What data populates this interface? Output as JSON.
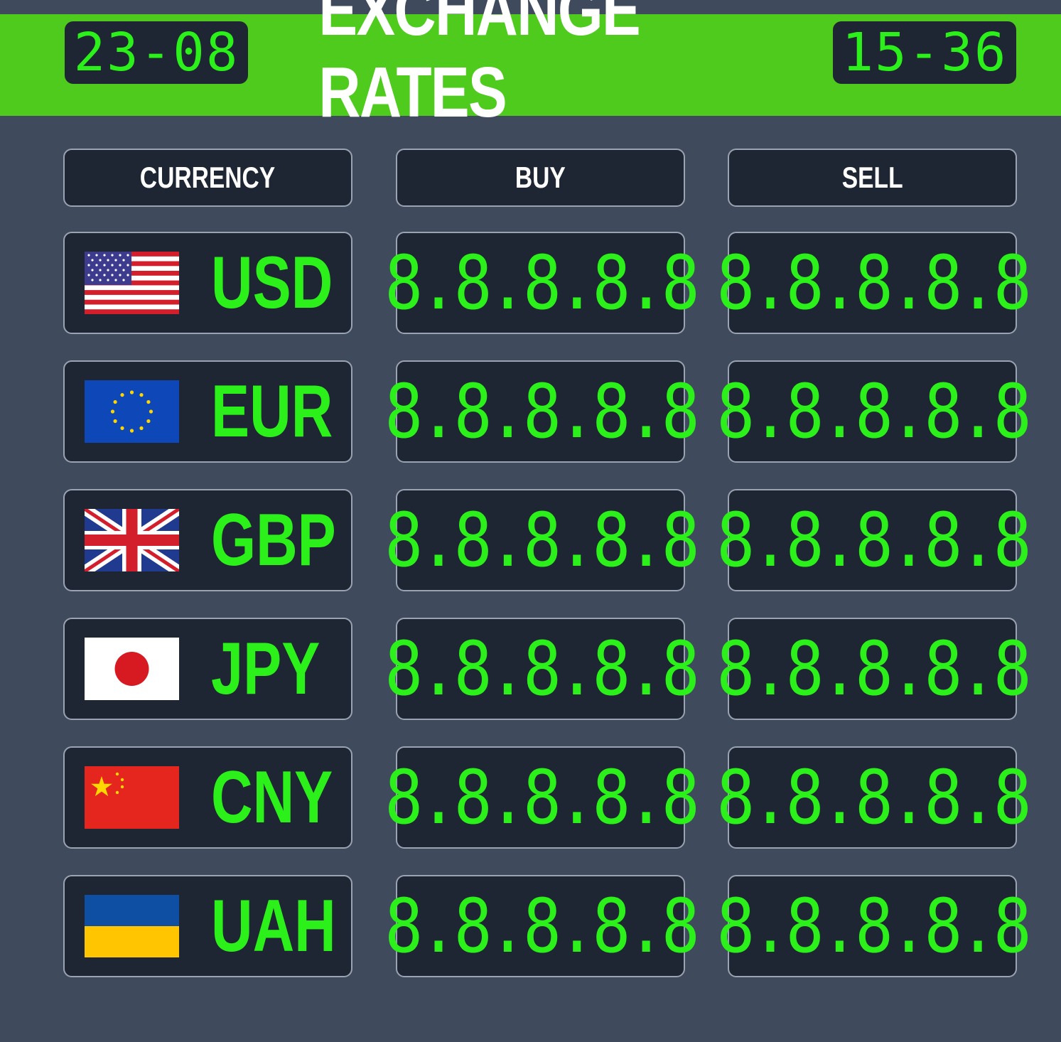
{
  "header": {
    "date": "23-08",
    "title": "EXCHANGE RATES",
    "time": "15-36",
    "bar_color": "#4fcb1d"
  },
  "columns": {
    "currency": "CURRENCY",
    "buy": "BUY",
    "sell": "SELL"
  },
  "rows": [
    {
      "code": "USD",
      "flag": "us-flag-icon",
      "buy": "8.8.8.8.8",
      "sell": "8.8.8.8.8"
    },
    {
      "code": "EUR",
      "flag": "eu-flag-icon",
      "buy": "8.8.8.8.8",
      "sell": "8.8.8.8.8"
    },
    {
      "code": "GBP",
      "flag": "uk-flag-icon",
      "buy": "8.8.8.8.8",
      "sell": "8.8.8.8.8"
    },
    {
      "code": "JPY",
      "flag": "japan-flag-icon",
      "buy": "8.8.8.8.8",
      "sell": "8.8.8.8.8"
    },
    {
      "code": "CNY",
      "flag": "china-flag-icon",
      "buy": "8.8.8.8.8",
      "sell": "8.8.8.8.8"
    },
    {
      "code": "UAH",
      "flag": "ukraine-flag-icon",
      "buy": "8.8.8.8.8",
      "sell": "8.8.8.8.8"
    }
  ],
  "colors": {
    "background": "#3f4b5d",
    "panel": "#1e2533",
    "digit_green": "#2bf01a",
    "panel_border": "#9aa3b1"
  }
}
